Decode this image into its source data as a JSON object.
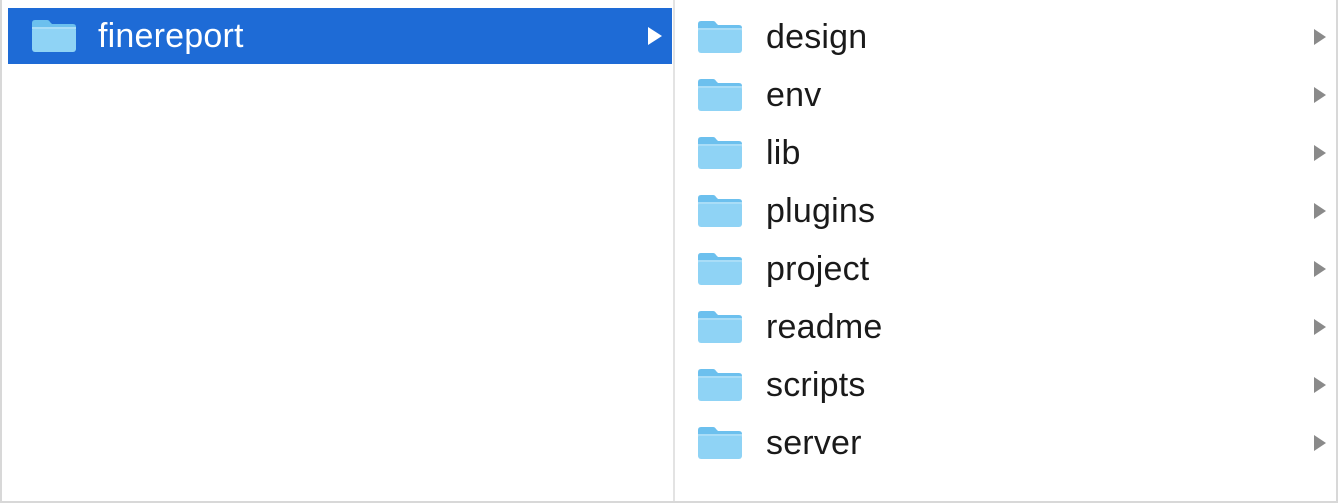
{
  "window": {
    "view": "column-view"
  },
  "colors": {
    "selection": "#1e6bd6",
    "folder_body": "#8fd3f5",
    "folder_tab": "#6cc0ee",
    "chevron": "#8a8a8a",
    "text": "#1a1a1a"
  },
  "columns": [
    {
      "items": [
        {
          "label": "finereport",
          "icon": "folder-icon",
          "selected": true,
          "has_children": true
        }
      ]
    },
    {
      "items": [
        {
          "label": "design",
          "icon": "folder-icon",
          "selected": false,
          "has_children": true
        },
        {
          "label": "env",
          "icon": "folder-icon",
          "selected": false,
          "has_children": true
        },
        {
          "label": "lib",
          "icon": "folder-icon",
          "selected": false,
          "has_children": true
        },
        {
          "label": "plugins",
          "icon": "folder-icon",
          "selected": false,
          "has_children": true
        },
        {
          "label": "project",
          "icon": "folder-icon",
          "selected": false,
          "has_children": true
        },
        {
          "label": "readme",
          "icon": "folder-icon",
          "selected": false,
          "has_children": true
        },
        {
          "label": "scripts",
          "icon": "folder-icon",
          "selected": false,
          "has_children": true
        },
        {
          "label": "server",
          "icon": "folder-icon",
          "selected": false,
          "has_children": true
        }
      ]
    }
  ]
}
